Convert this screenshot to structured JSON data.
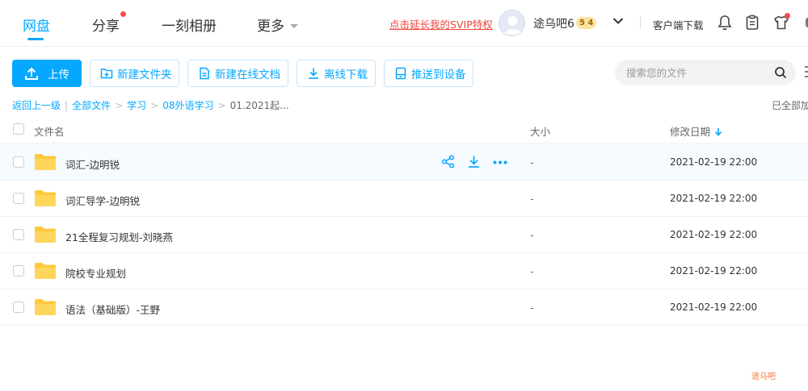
{
  "nav": {
    "items": [
      {
        "label": "网盘",
        "active": true
      },
      {
        "label": "分享",
        "has_dot": true
      },
      {
        "label": "一刻相册"
      },
      {
        "label": "更多",
        "has_chevron": true
      }
    ]
  },
  "header": {
    "svip_promo": "点击延长我的SVIP特权",
    "username": "途乌吧6",
    "vip_levels": "5 4",
    "client_download": "客户端下载",
    "icons": [
      "bell-icon",
      "clipboard-icon",
      "shirt-icon"
    ]
  },
  "toolbar": {
    "upload": "上传",
    "new_folder": "新建文件夹",
    "new_online_doc": "新建在线文档",
    "offline_download": "离线下载",
    "push_to_device": "推送到设备",
    "search_placeholder": "搜索您的文件"
  },
  "breadcrumb": {
    "back": "返回上一级",
    "items": [
      "全部文件",
      "学习",
      "08外语学习"
    ],
    "current": "01.2021起...",
    "loaded_status": "已全部加载"
  },
  "table": {
    "headers": {
      "name": "文件名",
      "size": "大小",
      "modified": "修改日期"
    },
    "rows": [
      {
        "name": "词汇-边明锐",
        "size": "-",
        "modified": "2021-02-19 22:00"
      },
      {
        "name": "词汇导学-边明锐",
        "size": "-",
        "modified": "2021-02-19 22:00"
      },
      {
        "name": "21全程复习规划-刘晓燕",
        "size": "-",
        "modified": "2021-02-19 22:00"
      },
      {
        "name": "院校专业规划",
        "size": "-",
        "modified": "2021-02-19 22:00"
      },
      {
        "name": "语法（基础版）-王野",
        "size": "-",
        "modified": "2021-02-19 22:00"
      }
    ]
  },
  "watermark": "途乌吧",
  "colors": {
    "accent": "#06a7ff",
    "promo": "#f2433b",
    "folder": "#ffc93c"
  }
}
